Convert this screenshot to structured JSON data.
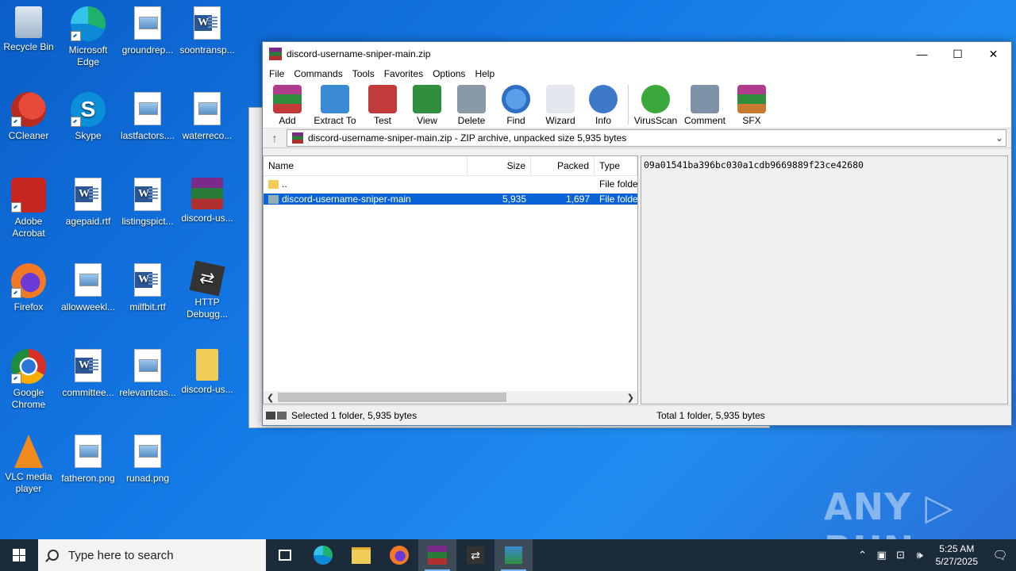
{
  "desktop": {
    "icons": [
      {
        "label": "Recycle Bin"
      },
      {
        "label": "Microsoft Edge"
      },
      {
        "label": "groundrep..."
      },
      {
        "label": "soontransp..."
      },
      {
        "label": "CCleaner"
      },
      {
        "label": "Skype"
      },
      {
        "label": "lastfactors...."
      },
      {
        "label": "waterreco..."
      },
      {
        "label": "Adobe Acrobat"
      },
      {
        "label": "agepaid.rtf"
      },
      {
        "label": "listingspict..."
      },
      {
        "label": "discord-us..."
      },
      {
        "label": "Firefox"
      },
      {
        "label": "allowweekl..."
      },
      {
        "label": "milfbit.rtf"
      },
      {
        "label": "HTTP Debugg..."
      },
      {
        "label": "Google Chrome"
      },
      {
        "label": "committee..."
      },
      {
        "label": "relevantcas..."
      },
      {
        "label": "discord-us..."
      },
      {
        "label": "VLC media player"
      },
      {
        "label": "fatheron.png"
      },
      {
        "label": "runad.png"
      }
    ]
  },
  "window": {
    "title": "discord-username-sniper-main.zip",
    "controls": {
      "minimize": "—",
      "maximize": "☐",
      "close": "✕"
    }
  },
  "menu": [
    "File",
    "Commands",
    "Tools",
    "Favorites",
    "Options",
    "Help"
  ],
  "toolbar": [
    {
      "label": "Add",
      "icon": "add-icon",
      "color": "#b03a8c"
    },
    {
      "label": "Extract To",
      "icon": "extract-icon",
      "color": "#3a8ad6"
    },
    {
      "label": "Test",
      "icon": "test-icon",
      "color": "#c23b3b"
    },
    {
      "label": "View",
      "icon": "view-icon",
      "color": "#2f8f3e"
    },
    {
      "label": "Delete",
      "icon": "delete-icon",
      "color": "#8a99a8"
    },
    {
      "label": "Find",
      "icon": "find-icon",
      "color": "#2d6fc4"
    },
    {
      "label": "Wizard",
      "icon": "wizard-icon",
      "color": "#9aa6b4"
    },
    {
      "label": "Info",
      "icon": "info-icon",
      "color": "#3d79c8"
    },
    {
      "label": "VirusScan",
      "icon": "virusscan-icon",
      "color": "#3aa83a"
    },
    {
      "label": "Comment",
      "icon": "comment-icon",
      "color": "#7f93a8"
    },
    {
      "label": "SFX",
      "icon": "sfx-icon",
      "color": "#c87a2e"
    }
  ],
  "address": {
    "up": "↑",
    "text": "discord-username-sniper-main.zip - ZIP archive, unpacked size 5,935 bytes",
    "chevron": "⌄"
  },
  "filelist": {
    "headers": {
      "name": "Name",
      "size": "Size",
      "packed": "Packed",
      "type": "Type"
    },
    "rows": [
      {
        "name": "..",
        "size": "",
        "packed": "",
        "type": "File folde"
      },
      {
        "name": "discord-username-sniper-main",
        "size": "5,935",
        "packed": "1,697",
        "type": "File folde"
      }
    ]
  },
  "comment": {
    "text": "09a01541ba396bc030a1cdb9669889f23ce42680"
  },
  "status": {
    "left": "Selected 1 folder, 5,935 bytes",
    "right": "Total 1 folder, 5,935 bytes"
  },
  "watermark": "ANY ▷ RUN",
  "taskbar": {
    "search_placeholder": "Type here to search",
    "time": "5:25 AM",
    "date": "5/27/2025"
  }
}
